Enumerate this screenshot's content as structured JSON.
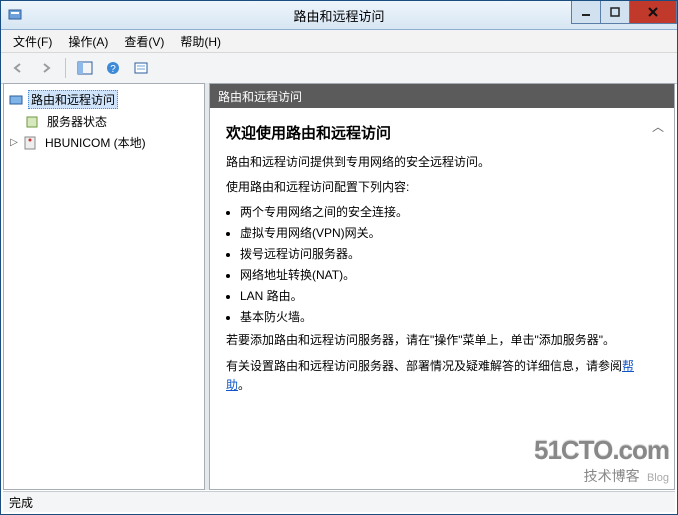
{
  "window": {
    "title": "路由和远程访问"
  },
  "menu": {
    "file": "文件(F)",
    "action": "操作(A)",
    "view": "查看(V)",
    "help": "帮助(H)"
  },
  "tree": {
    "root": "路由和远程访问",
    "item_status": "服务器状态",
    "item_server": "HBUNICOM (本地)"
  },
  "content": {
    "header": "路由和远程访问",
    "h2": "欢迎使用路由和远程访问",
    "p1": "路由和远程访问提供到专用网络的安全远程访问。",
    "p2": "使用路由和远程访问配置下列内容:",
    "li1": "两个专用网络之间的安全连接。",
    "li2": "虚拟专用网络(VPN)网关。",
    "li3": "拨号远程访问服务器。",
    "li4": "网络地址转换(NAT)。",
    "li5": "LAN 路由。",
    "li6": "基本防火墙。",
    "p3a": "若要添加路由和远程访问服务器，请在\"操作\"菜单上，单击\"添加服务器\"。",
    "p4a": "有关设置路由和远程访问服务器、部署情况及疑难解答的详细信息，请参阅",
    "help_label": "帮助",
    "p4b": "。"
  },
  "status": {
    "text": "完成"
  },
  "watermark": {
    "line1": "51CTO.com",
    "line2": "技术博客",
    "tag": "Blog"
  }
}
